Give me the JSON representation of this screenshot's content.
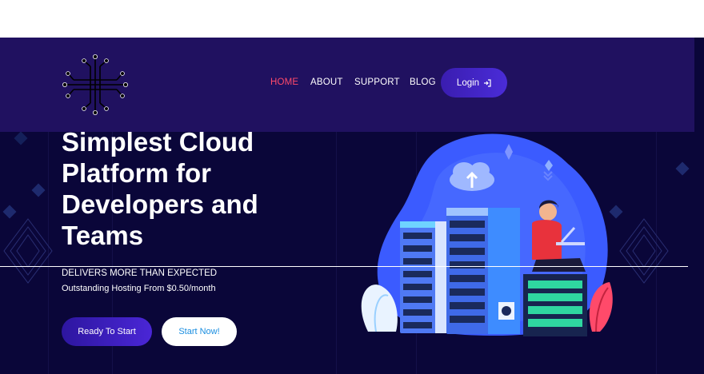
{
  "colors": {
    "nav_bg": "#201160",
    "hero_bg": "#0a0639",
    "accent_active": "#ff4a6a",
    "button_gradient": "#3a1db0",
    "secondary_button_text": "#1a8ee0"
  },
  "nav": {
    "logo_icon": "circuit-logo-icon",
    "links": [
      {
        "label": "HOME",
        "active": true
      },
      {
        "label": "ABOUT",
        "active": false
      },
      {
        "label": "SUPPORT",
        "active": false
      },
      {
        "label": "BLOG",
        "active": false
      }
    ],
    "login_label": "Login",
    "login_icon": "login-arrow-icon"
  },
  "hero": {
    "headline_lines": [
      "Simplest Cloud",
      "Platform for",
      "Developers and",
      "Teams"
    ],
    "tagline": "DELIVERS MORE THAN EXPECTED",
    "subline": "Outstanding Hosting From $0.50/month",
    "primary_button": "Ready To Start",
    "secondary_button": "Start Now!",
    "illustration": "developer-with-servers-illustration"
  }
}
